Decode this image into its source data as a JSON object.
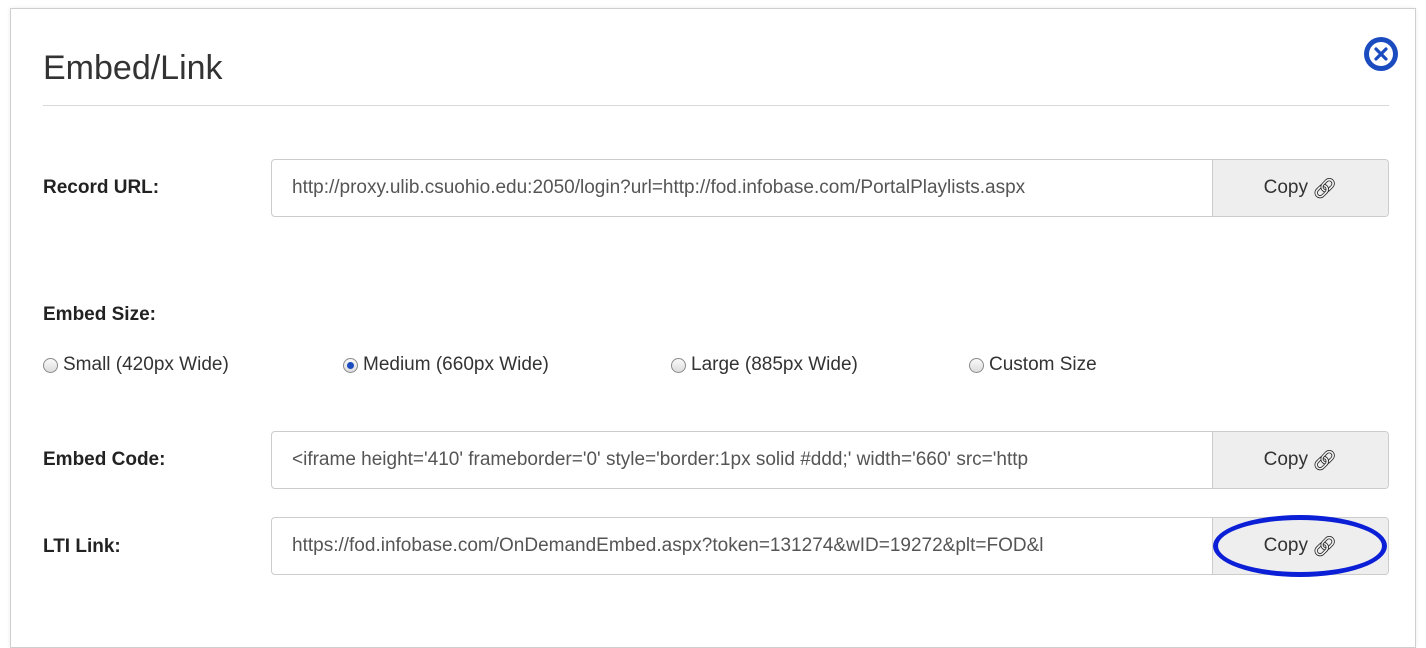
{
  "dialog": {
    "title": "Embed/Link",
    "close_icon": "close-circle-icon"
  },
  "record_url": {
    "label": "Record URL:",
    "value": "http://proxy.ulib.csuohio.edu:2050/login?url=http://fod.infobase.com/PortalPlaylists.aspx",
    "copy_label": "Copy"
  },
  "embed_size": {
    "label": "Embed Size:",
    "options": [
      {
        "label": "Small (420px Wide)",
        "checked": false
      },
      {
        "label": "Medium (660px Wide)",
        "checked": true
      },
      {
        "label": "Large (885px Wide)",
        "checked": false
      },
      {
        "label": "Custom Size",
        "checked": false
      }
    ]
  },
  "embed_code": {
    "label": "Embed Code:",
    "value": "<iframe height='410' frameborder='0' style='border:1px solid #ddd;' width='660' src='http",
    "copy_label": "Copy"
  },
  "lti_link": {
    "label": "LTI Link:",
    "value": "https://fod.infobase.com/OnDemandEmbed.aspx?token=131274&wID=19272&plt=FOD&l",
    "copy_label": "Copy"
  },
  "icons": {
    "copy": "link-icon",
    "highlight_color": "#0b1fd6",
    "accent": "#1a4bbf"
  }
}
